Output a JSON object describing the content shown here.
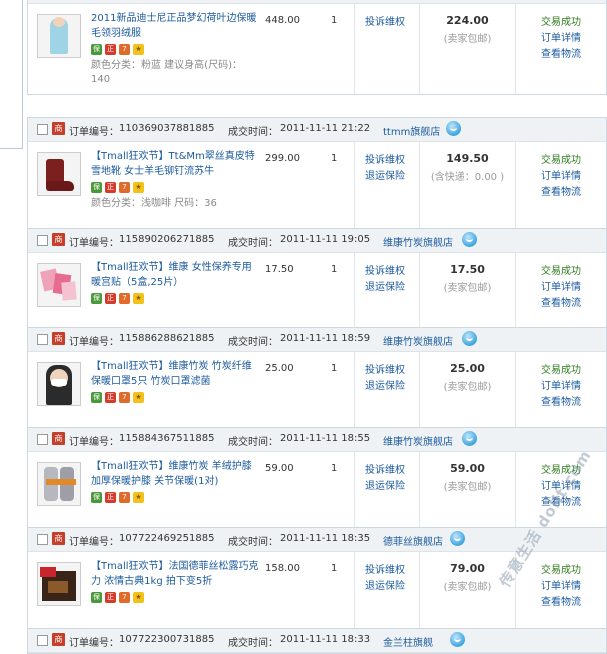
{
  "labels": {
    "order_no": "订单编号：",
    "deal_time": "成交时间：",
    "complain": "投诉维权",
    "return_insurance": "退运保险",
    "detail": "订单详情",
    "logistics": "查看物流",
    "shop_badge": "商"
  },
  "orders": [
    {
      "order_no": "",
      "time": "",
      "shop": "",
      "title": "2011新品迪士尼正品梦幻荷叶边保暖毛领羽绒服",
      "attrs": "颜色分类：粉蓝  建议身高(尺码)：140",
      "price": "448.00",
      "qty": "1",
      "total": "224.00",
      "shipping_note": "(卖家包邮)",
      "status": "交易成功",
      "has_return": false
    },
    {
      "order_no": "110369037881885",
      "time": "2011-11-11 21:22",
      "shop": "ttmm旗舰店",
      "title": "【Tmall狂欢节】Tt&Mm翠丝真皮特雪地靴 女士羊毛铆钉流苏牛",
      "attrs": "颜色分类：浅咖啡  尺码：36",
      "price": "299.00",
      "qty": "1",
      "total": "149.50",
      "shipping_note": "(含快递：0.00 )",
      "status": "交易成功",
      "has_return": true
    },
    {
      "order_no": "115890206271885",
      "time": "2011-11-11 19:05",
      "shop": "维康竹炭旗舰店",
      "title": "【Tmall狂欢节】维康 女性保养专用暖宫贴（5盒,25片）",
      "attrs": "",
      "price": "17.50",
      "qty": "1",
      "total": "17.50",
      "shipping_note": "(卖家包邮)",
      "status": "交易成功",
      "has_return": true
    },
    {
      "order_no": "115886288621885",
      "time": "2011-11-11 18:59",
      "shop": "维康竹炭旗舰店",
      "title": "【Tmall狂欢节】维康竹炭 竹炭纤维保暖口罩5只 竹炭口罩滤菌",
      "attrs": "",
      "price": "25.00",
      "qty": "1",
      "total": "25.00",
      "shipping_note": "(卖家包邮)",
      "status": "交易成功",
      "has_return": true
    },
    {
      "order_no": "115884367511885",
      "time": "2011-11-11 18:55",
      "shop": "维康竹炭旗舰店",
      "title": "【Tmall狂欢节】维康竹炭 羊绒护膝 加厚保暖护膝 关节保暖(1对)",
      "attrs": "",
      "price": "59.00",
      "qty": "1",
      "total": "59.00",
      "shipping_note": "(卖家包邮)",
      "status": "交易成功",
      "has_return": true
    },
    {
      "order_no": "107722469251885",
      "time": "2011-11-11 18:35",
      "shop": "德菲丝旗舰店",
      "title": "【Tmall狂欢节】法国德菲丝松露巧克力 浓情古典1kg 拍下变5折",
      "attrs": "",
      "price": "158.00",
      "qty": "1",
      "total": "79.00",
      "shipping_note": "(卖家包邮)",
      "status": "交易成功",
      "has_return": true
    },
    {
      "order_no": "107722300731885",
      "time": "2011-11-11 18:33",
      "shop": "金兰柱旗舰",
      "title": "",
      "attrs": "",
      "price": "",
      "qty": "",
      "total": "",
      "shipping_note": "",
      "status": "",
      "has_return": false
    }
  ],
  "watermark": "传意生活 dolit.com"
}
